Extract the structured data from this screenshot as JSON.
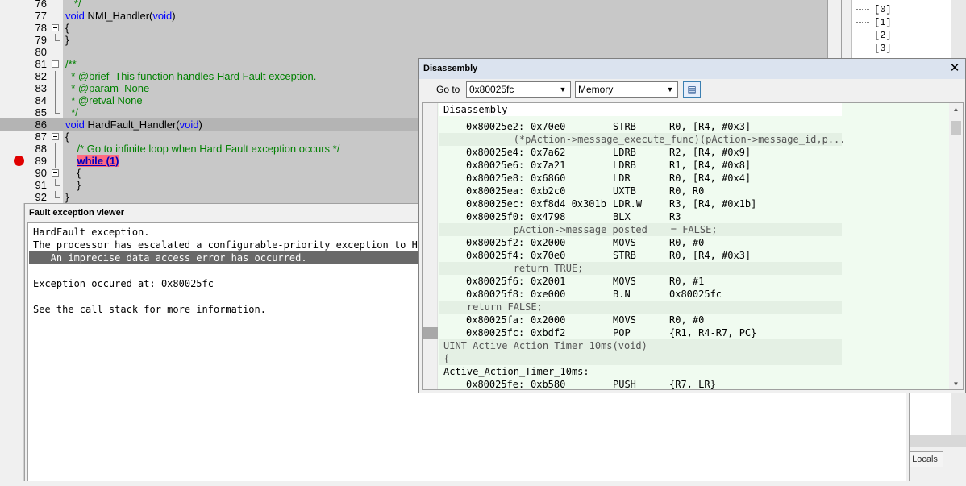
{
  "editor": {
    "lines": [
      {
        "no": "76",
        "parts": [
          {
            "t": "   */",
            "c": "cm"
          }
        ]
      },
      {
        "no": "77",
        "parts": [
          {
            "t": "void",
            "c": "kw"
          },
          {
            "t": " NMI_Handler(",
            "c": ""
          },
          {
            "t": "void",
            "c": "kw"
          },
          {
            "t": ")",
            "c": ""
          }
        ]
      },
      {
        "no": "78",
        "fold": "box",
        "parts": [
          {
            "t": "{",
            "c": ""
          }
        ]
      },
      {
        "no": "79",
        "fold": "end",
        "parts": [
          {
            "t": "}",
            "c": ""
          }
        ]
      },
      {
        "no": "80",
        "parts": []
      },
      {
        "no": "81",
        "fold": "box",
        "parts": [
          {
            "t": "/**",
            "c": "cm"
          }
        ]
      },
      {
        "no": "82",
        "fold": "line",
        "parts": [
          {
            "t": "  * @brief  This function handles Hard Fault exception.",
            "c": "cm"
          }
        ]
      },
      {
        "no": "83",
        "fold": "line",
        "parts": [
          {
            "t": "  * @param  None",
            "c": "cm"
          }
        ]
      },
      {
        "no": "84",
        "fold": "line",
        "parts": [
          {
            "t": "  * @retval None",
            "c": "cm"
          }
        ]
      },
      {
        "no": "85",
        "fold": "end",
        "parts": [
          {
            "t": "  */",
            "c": "cm"
          }
        ]
      },
      {
        "no": "86",
        "cur": true,
        "parts": [
          {
            "t": "void",
            "c": "kw"
          },
          {
            "t": " HardFault_Handler(",
            "c": ""
          },
          {
            "t": "void",
            "c": "kw"
          },
          {
            "t": ")",
            "c": ""
          }
        ]
      },
      {
        "no": "87",
        "fold": "box",
        "parts": [
          {
            "t": "{",
            "c": ""
          }
        ]
      },
      {
        "no": "88",
        "fold": "line",
        "parts": [
          {
            "t": "    /* Go to infinite loop when Hard Fault exception occurs */",
            "c": "cm"
          }
        ]
      },
      {
        "no": "89",
        "fold": "line",
        "bp": true,
        "parts": [
          {
            "t": "    ",
            "c": ""
          },
          {
            "t": "while (1)",
            "c": "hl"
          }
        ]
      },
      {
        "no": "90",
        "fold": "box",
        "parts": [
          {
            "t": "    {",
            "c": ""
          }
        ]
      },
      {
        "no": "91",
        "fold": "end",
        "parts": [
          {
            "t": "    }",
            "c": ""
          }
        ]
      },
      {
        "no": "92",
        "fold": "end",
        "parts": [
          {
            "t": "}",
            "c": ""
          }
        ]
      }
    ]
  },
  "tree": {
    "items": [
      "[0]",
      "[1]",
      "[2]",
      "[3]"
    ]
  },
  "locals_tab": "Locals",
  "fault_viewer": {
    "title": "Fault exception viewer",
    "lines": [
      {
        "text": "HardFault exception.",
        "sel": false
      },
      {
        "text": "The processor has escalated a configurable-priority exception to HardFault.",
        "sel": false
      },
      {
        "text": "   An imprecise data access error has occurred.",
        "sel": true
      },
      {
        "text": "",
        "sel": false
      },
      {
        "text": "Exception occured at: 0x80025fc",
        "sel": false
      },
      {
        "text": "",
        "sel": false
      },
      {
        "text": "See the call stack for more information.",
        "sel": false
      }
    ]
  },
  "disassembly": {
    "title": "Disassembly",
    "close_glyph": "✕",
    "goto_label": "Go to",
    "goto_value": "0x80025fc",
    "memory_value": "Memory",
    "header": "Disassembly",
    "rows": [
      {
        "kind": "asm",
        "addr": "0x80025e2:",
        "bytes": "0x70e0",
        "op": "STRB",
        "args": "R0, [R4, #0x3]"
      },
      {
        "kind": "src",
        "text": "            (*pAction->message_execute_func)(pAction->message_id,p..."
      },
      {
        "kind": "asm",
        "addr": "0x80025e4:",
        "bytes": "0x7a62",
        "op": "LDRB",
        "args": "R2, [R4, #0x9]"
      },
      {
        "kind": "asm",
        "addr": "0x80025e6:",
        "bytes": "0x7a21",
        "op": "LDRB",
        "args": "R1, [R4, #0x8]"
      },
      {
        "kind": "asm",
        "addr": "0x80025e8:",
        "bytes": "0x6860",
        "op": "LDR",
        "args": "R0, [R4, #0x4]"
      },
      {
        "kind": "asm",
        "addr": "0x80025ea:",
        "bytes": "0xb2c0",
        "op": "UXTB",
        "args": "R0, R0"
      },
      {
        "kind": "asm",
        "addr": "0x80025ec:",
        "bytes": "0xf8d4 0x301b",
        "op": "LDR.W",
        "args": "R3, [R4, #0x1b]"
      },
      {
        "kind": "asm",
        "addr": "0x80025f0:",
        "bytes": "0x4798",
        "op": "BLX",
        "args": "R3"
      },
      {
        "kind": "src",
        "text": "            pAction->message_posted    = FALSE;"
      },
      {
        "kind": "asm",
        "addr": "0x80025f2:",
        "bytes": "0x2000",
        "op": "MOVS",
        "args": "R0, #0"
      },
      {
        "kind": "asm",
        "addr": "0x80025f4:",
        "bytes": "0x70e0",
        "op": "STRB",
        "args": "R0, [R4, #0x3]"
      },
      {
        "kind": "src",
        "text": "            return TRUE;"
      },
      {
        "kind": "asm",
        "addr": "0x80025f6:",
        "bytes": "0x2001",
        "op": "MOVS",
        "args": "R0, #1"
      },
      {
        "kind": "asm",
        "addr": "0x80025f8:",
        "bytes": "0xe000",
        "op": "B.N",
        "args": "0x80025fc"
      },
      {
        "kind": "src",
        "text": "    return FALSE;"
      },
      {
        "kind": "asm",
        "addr": "0x80025fa:",
        "bytes": "0x2000",
        "op": "MOVS",
        "args": "R0, #0"
      },
      {
        "kind": "asm",
        "addr": "0x80025fc:",
        "bytes": "0xbdf2",
        "op": "POP",
        "args": "{R1, R4-R7, PC}",
        "current": true
      },
      {
        "kind": "src",
        "text": "UINT Active_Action_Timer_10ms(void)"
      },
      {
        "kind": "src",
        "text": "{"
      },
      {
        "kind": "label",
        "text": "Active_Action_Timer_10ms:"
      },
      {
        "kind": "asm",
        "addr": "0x80025fe:",
        "bytes": "0xb580",
        "op": "PUSH",
        "args": "{R7, LR}"
      }
    ]
  },
  "colors": {
    "editor_bg": "#c8c8c8",
    "keyword": "#0000ff",
    "comment": "#008000",
    "breakpoint": "#e00000",
    "disasm_bg": "#f0fbf0",
    "fault_selected": "#696969"
  }
}
